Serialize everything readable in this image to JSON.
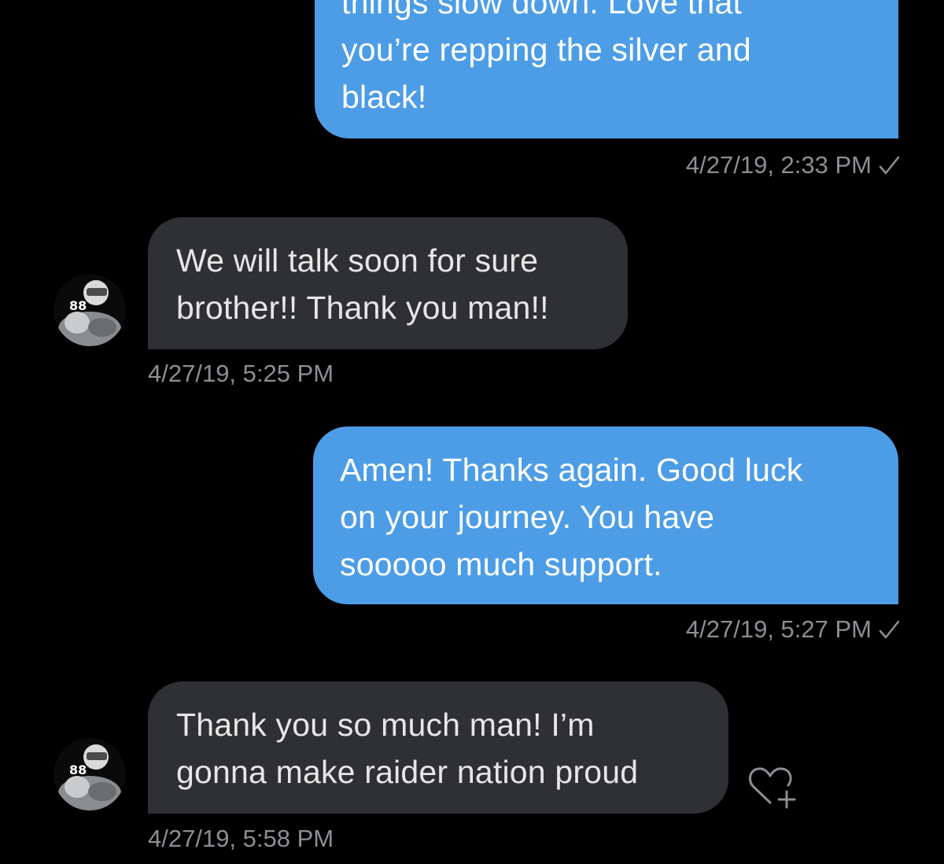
{
  "messages": [
    {
      "id": "m1",
      "direction": "out",
      "lines": [
        "things slow down. Love that",
        "you’re repping the silver and",
        "black!"
      ],
      "timestamp": "4/27/19, 2:33 PM",
      "delivered_icon": "checkmark-icon"
    },
    {
      "id": "m2",
      "direction": "in",
      "lines": [
        "We will talk soon for sure",
        "brother!! Thank you man!!"
      ],
      "timestamp": "4/27/19, 5:25 PM",
      "avatar_icon": "avatar-icon"
    },
    {
      "id": "m3",
      "direction": "out",
      "lines": [
        "Amen! Thanks again. Good luck",
        "on your journey. You have",
        "sooooo much support."
      ],
      "timestamp": "4/27/19, 5:27 PM",
      "delivered_icon": "checkmark-icon"
    },
    {
      "id": "m4",
      "direction": "in",
      "lines": [
        "Thank you so much man! I’m",
        "gonna make raider nation proud"
      ],
      "timestamp": "4/27/19, 5:58 PM",
      "avatar_icon": "avatar-icon",
      "reaction_icon": "heart-plus-icon"
    }
  ],
  "colors": {
    "background": "#000000",
    "outgoing_bubble": "#4d9de6",
    "incoming_bubble": "#2f3033",
    "timestamp": "#8b8f94"
  }
}
